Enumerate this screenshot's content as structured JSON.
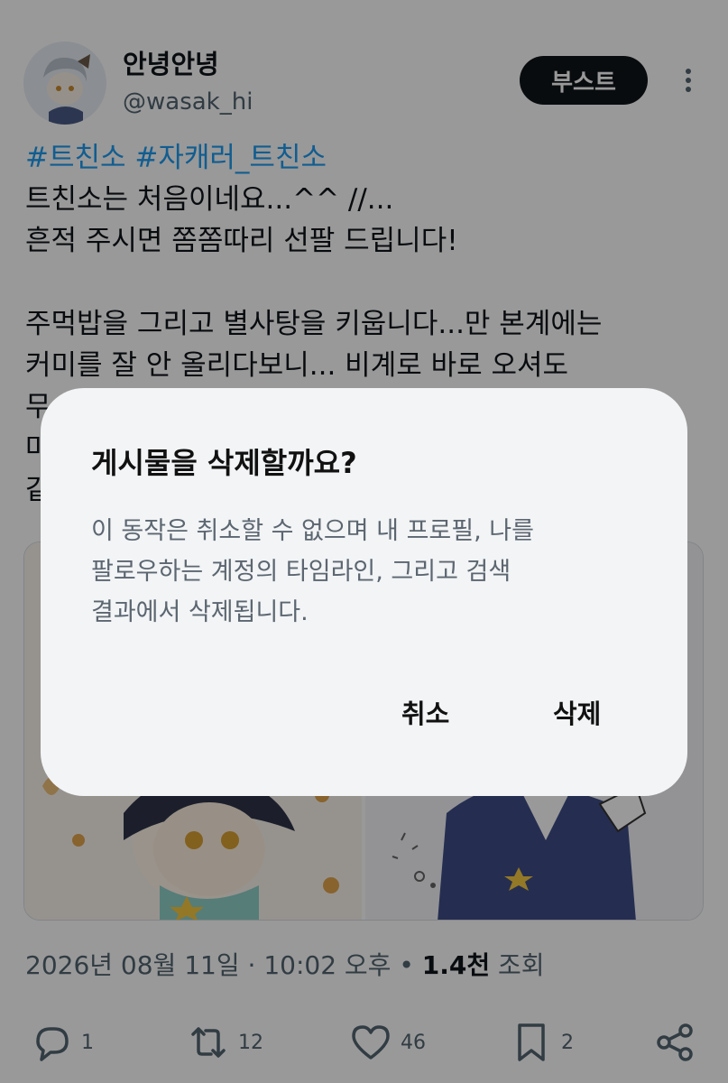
{
  "user": {
    "display_name": "안녕안녕",
    "handle": "@wasak_hi"
  },
  "boost_label": "부스트",
  "post": {
    "hashtags": "#트친소 #자캐러_트친소",
    "lines": [
      "트친소는 처음이네요...^^ //...",
      "흔적 주시면 쫌쫌따리 선팔 드립니다!",
      "",
      "주먹밥을 그리고 별사탕을 키웁니다...만 본계에는",
      "커미를 잘 안 올리다보니... 비계로 바로 오셔도",
      "무",
      "마",
      "같"
    ]
  },
  "meta": {
    "date": "2026년 08월 11일",
    "separator1": " · ",
    "time": "10:02 오후",
    "bullet": " • ",
    "views_count": "1.4천",
    "views_label": " 조회"
  },
  "actions": {
    "replies": "1",
    "reposts": "12",
    "likes": "46",
    "bookmarks": "2"
  },
  "dialog": {
    "title": "게시물을 삭제할까요?",
    "body_lines": [
      "이 동작은 취소할 수 없으며 내 프로필, 나를",
      "팔로우하는 계정의 타임라인, 그리고 검색",
      "결과에서 삭제됩니다."
    ],
    "cancel_label": "취소",
    "delete_label": "삭제"
  },
  "colors": {
    "hashtag": "#1d9bf0",
    "dialog_bg": "#f2f4f6",
    "overlay": "rgba(0,0,0,0.40)"
  }
}
